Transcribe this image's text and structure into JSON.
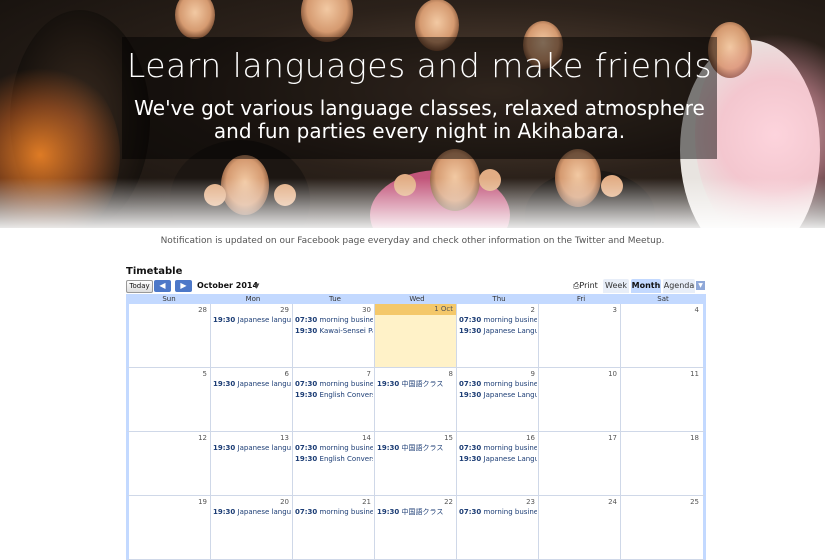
{
  "hero": {
    "title": "Learn languages and make friends",
    "subtitle_line1": "We've got various language classes, relaxed atmosphere",
    "subtitle_line2": "and fun parties every night in Akihabara."
  },
  "notice": "Notification is updated on our Facebook page everyday and check other information on the Twitter and Meetup.",
  "calendar": {
    "title": "Timetable",
    "today_label": "Today",
    "prev_icon": "chevron-left-icon",
    "next_icon": "chevron-right-icon",
    "month_label": "October 2014",
    "print_label": "Print",
    "view_tabs": [
      "Week",
      "Month",
      "Agenda"
    ],
    "active_view": "Month",
    "weekdays": [
      "Sun",
      "Mon",
      "Tue",
      "Wed",
      "Thu",
      "Fri",
      "Sat"
    ],
    "colors": {
      "header_bg": "#c3d9ff",
      "today_bg": "#fff2c8",
      "today_header": "#f4c86a",
      "event_text": "#1c3d75",
      "nav_button": "#4d78c8"
    },
    "weeks": [
      {
        "days": [
          {
            "num": "28",
            "events": []
          },
          {
            "num": "29",
            "events": [
              {
                "time": "19:30",
                "title": "Japanese language"
              }
            ]
          },
          {
            "num": "30",
            "events": [
              {
                "time": "07:30",
                "title": "morning business"
              },
              {
                "time": "19:30",
                "title": "Kawai-Sensei Pare"
              }
            ]
          },
          {
            "num": "1 Oct",
            "today": true,
            "events": []
          },
          {
            "num": "2",
            "events": [
              {
                "time": "07:30",
                "title": "morning business"
              },
              {
                "time": "19:30",
                "title": "Japanese Languag"
              }
            ]
          },
          {
            "num": "3",
            "events": []
          },
          {
            "num": "4",
            "events": []
          }
        ]
      },
      {
        "days": [
          {
            "num": "5",
            "events": []
          },
          {
            "num": "6",
            "events": [
              {
                "time": "19:30",
                "title": "Japanese language"
              }
            ]
          },
          {
            "num": "7",
            "events": [
              {
                "time": "07:30",
                "title": "morning business"
              },
              {
                "time": "19:30",
                "title": "English Conversat"
              }
            ]
          },
          {
            "num": "8",
            "events": [
              {
                "time": "19:30",
                "title": "中国語クラス"
              }
            ]
          },
          {
            "num": "9",
            "events": [
              {
                "time": "07:30",
                "title": "morning business"
              },
              {
                "time": "19:30",
                "title": "Japanese Languag"
              }
            ]
          },
          {
            "num": "10",
            "events": []
          },
          {
            "num": "11",
            "events": []
          }
        ]
      },
      {
        "days": [
          {
            "num": "12",
            "events": []
          },
          {
            "num": "13",
            "events": [
              {
                "time": "19:30",
                "title": "Japanese language"
              }
            ]
          },
          {
            "num": "14",
            "events": [
              {
                "time": "07:30",
                "title": "morning business"
              },
              {
                "time": "19:30",
                "title": "English Conversat"
              }
            ]
          },
          {
            "num": "15",
            "events": [
              {
                "time": "19:30",
                "title": "中国語クラス"
              }
            ]
          },
          {
            "num": "16",
            "events": [
              {
                "time": "07:30",
                "title": "morning business"
              },
              {
                "time": "19:30",
                "title": "Japanese Languag"
              }
            ]
          },
          {
            "num": "17",
            "events": []
          },
          {
            "num": "18",
            "events": []
          }
        ]
      },
      {
        "days": [
          {
            "num": "19",
            "events": []
          },
          {
            "num": "20",
            "events": [
              {
                "time": "19:30",
                "title": "Japanese language"
              }
            ]
          },
          {
            "num": "21",
            "events": [
              {
                "time": "07:30",
                "title": "morning business"
              }
            ]
          },
          {
            "num": "22",
            "events": [
              {
                "time": "19:30",
                "title": "中国語クラス"
              }
            ]
          },
          {
            "num": "23",
            "events": [
              {
                "time": "07:30",
                "title": "morning business"
              }
            ]
          },
          {
            "num": "24",
            "events": []
          },
          {
            "num": "25",
            "events": []
          }
        ]
      }
    ]
  }
}
